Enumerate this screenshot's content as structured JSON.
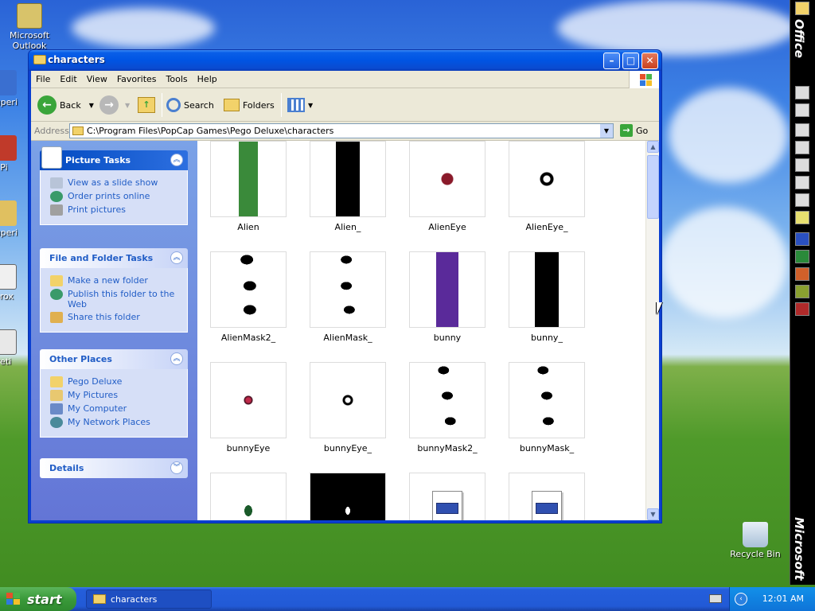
{
  "desktop": {
    "icons": [
      {
        "label": "Microsoft Outlook",
        "name": "desktop-icon-outlook"
      },
      {
        "label": "superi",
        "name": "desktop-icon-superi"
      },
      {
        "label": "Pi",
        "name": "desktop-icon-pi"
      },
      {
        "label": "superi",
        "name": "desktop-icon-superi-2"
      },
      {
        "label": "prox",
        "name": "desktop-icon-prox"
      },
      {
        "label": "reti",
        "name": "desktop-icon-reti"
      },
      {
        "label": "Recycle Bin",
        "name": "desktop-icon-recycle-bin"
      }
    ]
  },
  "window": {
    "title": "characters",
    "menu": [
      "File",
      "Edit",
      "View",
      "Favorites",
      "Tools",
      "Help"
    ],
    "toolbar": {
      "back": "Back",
      "search": "Search",
      "folders": "Folders"
    },
    "address": {
      "label": "Address",
      "path": "C:\\Program Files\\PopCap Games\\Pego Deluxe\\characters",
      "go": "Go"
    }
  },
  "left_pane": {
    "picture_tasks": {
      "title": "Picture Tasks",
      "items": [
        "View as a slide show",
        "Order prints online",
        "Print pictures"
      ]
    },
    "file_folder_tasks": {
      "title": "File and Folder Tasks",
      "items": [
        "Make a new folder",
        "Publish this folder to the Web",
        "Share this folder"
      ]
    },
    "other_places": {
      "title": "Other Places",
      "items": [
        "Pego Deluxe",
        "My Pictures",
        "My Computer",
        "My Network Places"
      ]
    },
    "details": {
      "title": "Details"
    }
  },
  "files": [
    {
      "name": "Alien"
    },
    {
      "name": "Alien_"
    },
    {
      "name": "AlienEye"
    },
    {
      "name": "AlienEye_"
    },
    {
      "name": "AlienMask2_"
    },
    {
      "name": "AlienMask_"
    },
    {
      "name": "bunny"
    },
    {
      "name": "bunny_"
    },
    {
      "name": "bunnyEye"
    },
    {
      "name": "bunnyEye_"
    },
    {
      "name": "bunnyMask2_"
    },
    {
      "name": "bunnyMask_"
    },
    {
      "name": ""
    },
    {
      "name": ""
    },
    {
      "name": ""
    },
    {
      "name": ""
    }
  ],
  "office_bar": {
    "top_label": "Office",
    "bottom_label": "Microsoft"
  },
  "taskbar": {
    "start": "start",
    "task": "characters",
    "clock": "12:01 AM"
  },
  "colors": {
    "title_blue": "#0054e3",
    "link_blue": "#215dc6",
    "pane_blue": "#7ba2e7",
    "start_green": "#3a9a3a"
  }
}
